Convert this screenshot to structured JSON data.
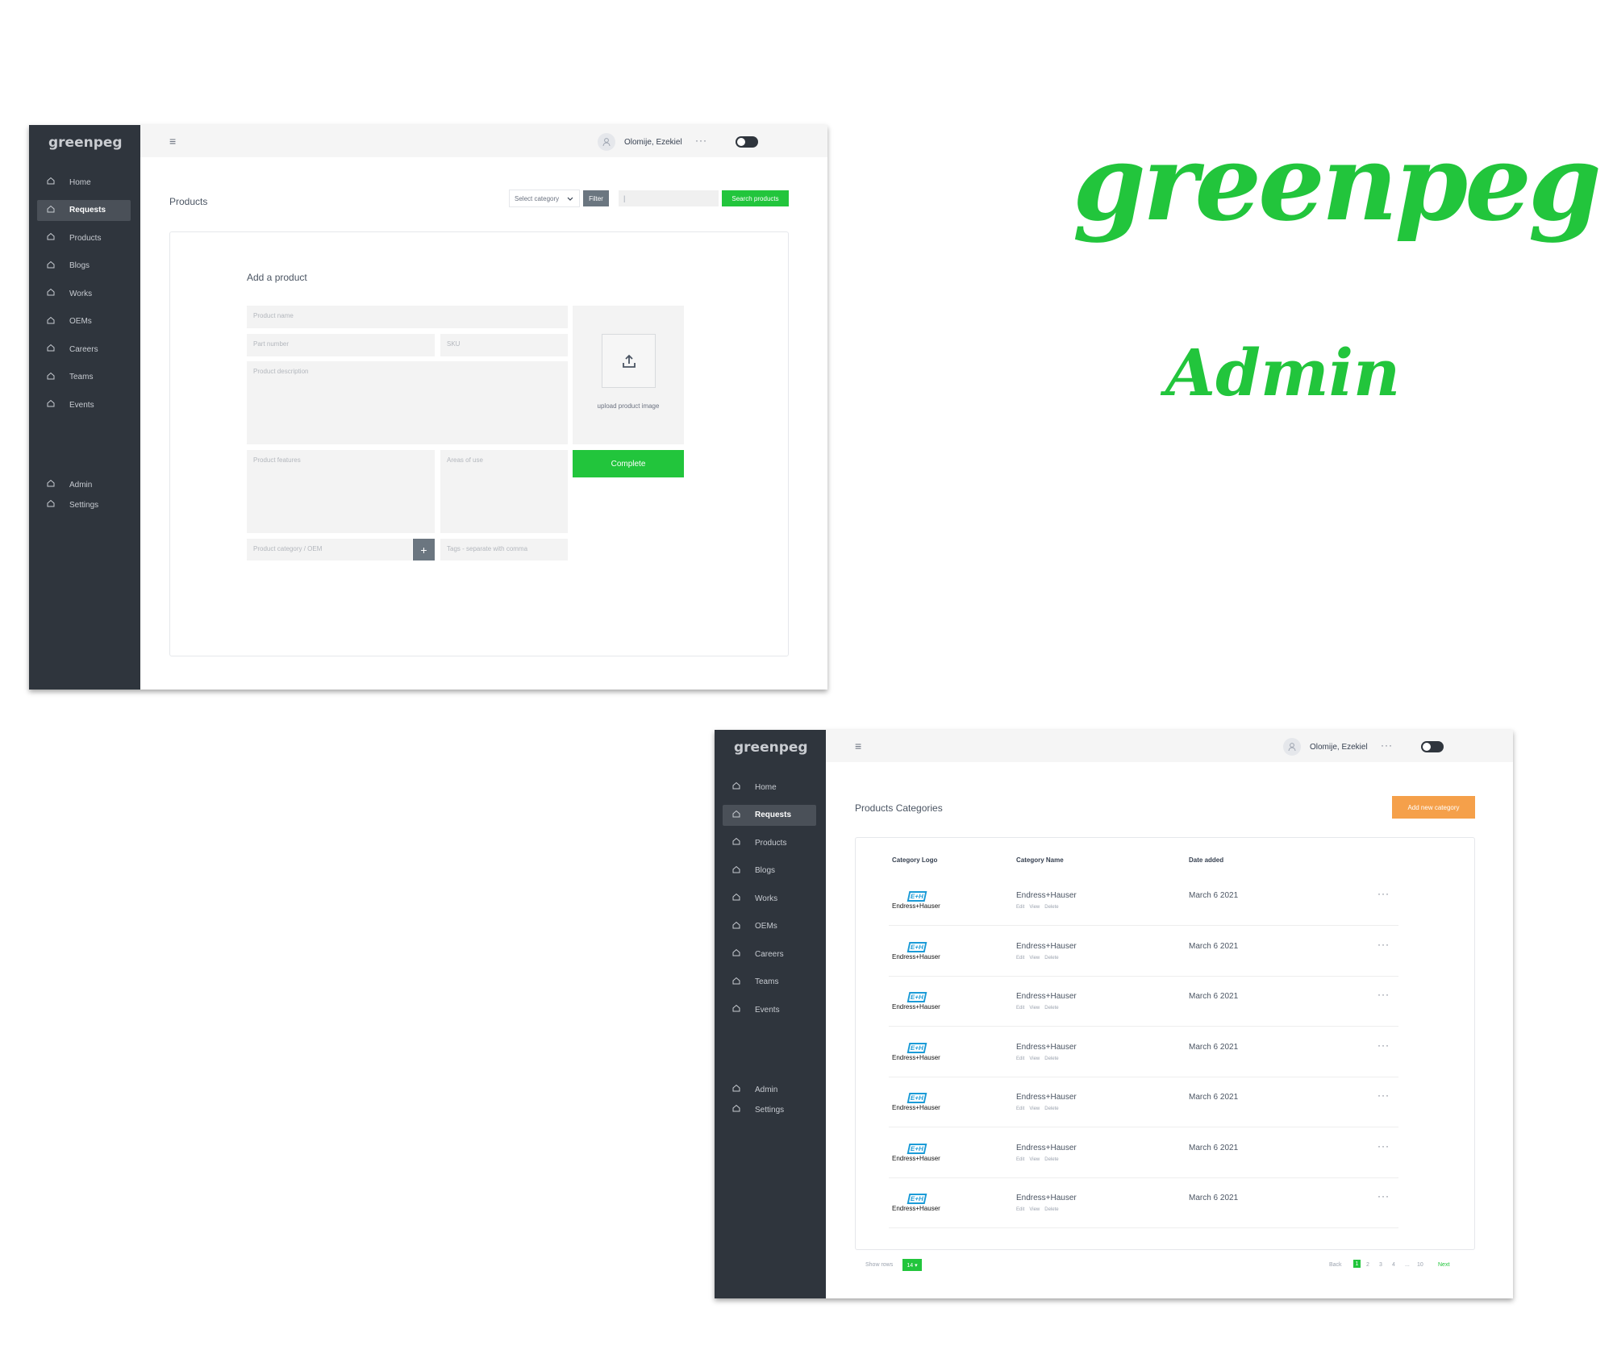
{
  "brand": {
    "name": "greenpeg",
    "tagline": "Admin",
    "accent": "#22c53c"
  },
  "sidebar": {
    "items": [
      {
        "label": "Home"
      },
      {
        "label": "Requests"
      },
      {
        "label": "Products"
      },
      {
        "label": "Blogs"
      },
      {
        "label": "Works"
      },
      {
        "label": "OEMs"
      },
      {
        "label": "Careers"
      },
      {
        "label": "Teams"
      },
      {
        "label": "Events"
      }
    ],
    "bottom": [
      {
        "label": "Admin"
      },
      {
        "label": "Settings"
      }
    ]
  },
  "header": {
    "user": "Olomije, Ezekiel",
    "more": "···"
  },
  "products_screen": {
    "title": "Products",
    "select_category": "Select category",
    "filter": "Filter",
    "search_value": "|",
    "search_button": "Search products",
    "form": {
      "heading": "Add a product",
      "product_name": "Product name",
      "part_number": "Part number",
      "sku": "SKU",
      "description": "Product description",
      "features": "Product features",
      "areas_of_use": "Areas of use",
      "category_oem": "Product category / OEM",
      "tags": "Tags - separate with comma",
      "plus": "+",
      "upload_label": "upload product image",
      "complete": "Complete"
    }
  },
  "categories_screen": {
    "title": "Products Categories",
    "add_button": "Add new category",
    "columns": {
      "logo": "Category Logo",
      "name": "Category Name",
      "date": "Date added"
    },
    "rows": [
      {
        "logo_mark": "E+H",
        "logo_text": "Endress+Hauser",
        "name": "Endress+Hauser",
        "date": "March 6 2021",
        "edit": "Edit",
        "view": "View",
        "delete": "Delete"
      },
      {
        "logo_mark": "E+H",
        "logo_text": "Endress+Hauser",
        "name": "Endress+Hauser",
        "date": "March 6 2021",
        "edit": "Edit",
        "view": "View",
        "delete": "Delete"
      },
      {
        "logo_mark": "E+H",
        "logo_text": "Endress+Hauser",
        "name": "Endress+Hauser",
        "date": "March 6 2021",
        "edit": "Edit",
        "view": "View",
        "delete": "Delete"
      },
      {
        "logo_mark": "E+H",
        "logo_text": "Endress+Hauser",
        "name": "Endress+Hauser",
        "date": "March 6 2021",
        "edit": "Edit",
        "view": "View",
        "delete": "Delete"
      },
      {
        "logo_mark": "E+H",
        "logo_text": "Endress+Hauser",
        "name": "Endress+Hauser",
        "date": "March 6 2021",
        "edit": "Edit",
        "view": "View",
        "delete": "Delete"
      },
      {
        "logo_mark": "E+H",
        "logo_text": "Endress+Hauser",
        "name": "Endress+Hauser",
        "date": "March 6 2021",
        "edit": "Edit",
        "view": "View",
        "delete": "Delete"
      },
      {
        "logo_mark": "E+H",
        "logo_text": "Endress+Hauser",
        "name": "Endress+Hauser",
        "date": "March 6 2021",
        "edit": "Edit",
        "view": "View",
        "delete": "Delete"
      }
    ],
    "footer": {
      "show_rows": "Show rows",
      "rows_value": "14 ▾",
      "back": "Back",
      "pages": [
        "1",
        "2",
        "3",
        "4",
        "...",
        "10"
      ],
      "next": "Next"
    }
  }
}
